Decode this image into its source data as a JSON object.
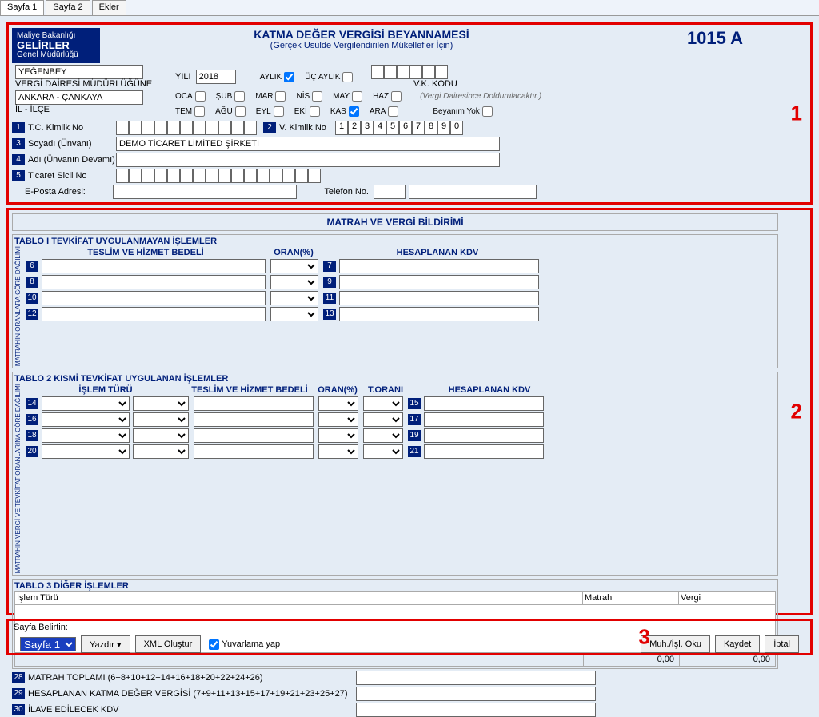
{
  "tabs": {
    "t1": "Sayfa 1",
    "t2": "Sayfa 2",
    "t3": "Ekler"
  },
  "header": {
    "ministry_top": "Maliye Bakanlığı",
    "ministry_main": "GELİRLER",
    "ministry_sub": "Genel Müdürlüğü",
    "title": "KATMA DEĞER VERGİSİ BEYANNAMESİ",
    "subtitle": "(Gerçek Usulde Vergilendirilen Mükellefler İçin)",
    "form_code": "1015 A",
    "vk_kodu_label": "V.K. KODU",
    "vk_note": "(Vergi Dairesince Doldurulacaktır.)",
    "vergi_dairesi_value": "YEĞENBEY",
    "vergi_dairesi_label": "VERGİ DAİRESİ MÜDÜRLÜĞÜNE",
    "il_ilce_value": "ANKARA - ÇANKAYA",
    "il_ilce_label": "İL - İLÇE",
    "yili_label": "YILI",
    "yili_value": "2018",
    "aylik_label": "AYLIK",
    "uc_aylik_label": "ÜÇ AYLIK",
    "beyanim_yok_label": "Beyanım Yok",
    "months": {
      "oca": "OCA",
      "sub": "ŞUB",
      "mar": "MAR",
      "nis": "NİS",
      "may": "MAY",
      "haz": "HAZ",
      "tem": "TEM",
      "agu": "AĞU",
      "eyl": "EYL",
      "eki": "EKİ",
      "kas": "KAS",
      "ara": "ARA"
    },
    "labels": {
      "l1": "T.C. Kimlik No",
      "l2": "V. Kimlik No",
      "l3": "Soyadı (Ünvanı)",
      "l4": "Adı (Ünvanın Devamı)",
      "l5": "Ticaret Sicil No",
      "eposta": "E-Posta Adresi:",
      "telefon": "Telefon No."
    },
    "soyadi_value": "DEMO TİCARET LİMİTED ŞİRKETİ",
    "vkimlik": [
      "1",
      "2",
      "3",
      "4",
      "5",
      "6",
      "7",
      "8",
      "9",
      "0"
    ]
  },
  "annotations": {
    "b1": "1",
    "b2": "2",
    "b3": "3"
  },
  "section2": {
    "main_header": "MATRAH VE VERGİ BİLDİRİMİ",
    "tablo1_title": "TABLO I   TEVKİFAT UYGULANMAYAN İŞLEMLER",
    "cols_t1": {
      "c1": "TESLİM VE HİZMET BEDELİ",
      "c2": "ORAN(%)",
      "c3": "HESAPLANAN KDV"
    },
    "side1": "MATRAHIN ORANLARA GÖRE DAĞILIMI",
    "nums_left": [
      "6",
      "8",
      "10",
      "12"
    ],
    "nums_right": [
      "7",
      "9",
      "11",
      "13"
    ],
    "tablo2_title": "TABLO 2   KISMİ TEVKİFAT UYGULANAN İŞLEMLER",
    "cols_t2": {
      "c1": "İŞLEM TÜRÜ",
      "c2": "TESLİM VE HİZMET BEDELİ",
      "c3": "ORAN(%)",
      "c4": "T.ORANI",
      "c5": "HESAPLANAN KDV"
    },
    "side2": "MATRAHIN VERGİ VE TEVKİFAT ORANLARINA GÖRE DAĞILIMI",
    "nums2_left": [
      "14",
      "16",
      "18",
      "20"
    ],
    "nums2_right": [
      "15",
      "17",
      "19",
      "21"
    ],
    "tablo3_title": "TABLO 3   DİĞER İŞLEMLER",
    "t3cols": {
      "c1": "İşlem Türü",
      "c2": "Matrah",
      "c3": "Vergi"
    },
    "tot_zero": "0,00",
    "f28_n": "28",
    "f28": "MATRAH TOPLAMI (6+8+10+12+14+16+18+20+22+24+26)",
    "f29_n": "29",
    "f29": "HESAPLANAN KATMA DEĞER VERGİSİ (7+9+11+13+15+17+19+21+23+25+27)",
    "f30_n": "30",
    "f30": "İLAVE EDİLECEK KDV"
  },
  "footer": {
    "sayfa_belirtin": "Sayfa Belirtin:",
    "sayfa_sel": "Sayfa 1",
    "yazdir": "Yazdır",
    "xml": "XML Oluştur",
    "yuvarlama": "Yuvarlama yap",
    "muh": "Muh./İşl. Oku",
    "kaydet": "Kaydet",
    "iptal": "İptal"
  }
}
